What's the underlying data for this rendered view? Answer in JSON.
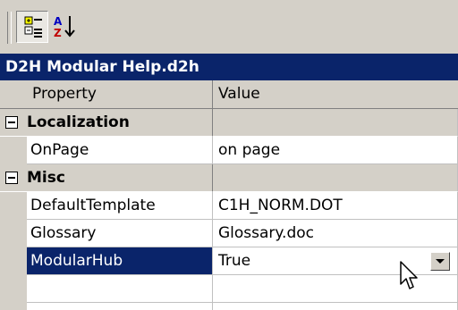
{
  "title": "D2H Modular Help.d2h",
  "toolbar": {
    "categorized_icon": "categorized-icon",
    "alphabetical_icon": "alphabetical-sort-icon"
  },
  "grid": {
    "header": {
      "property": "Property",
      "value": "Value"
    },
    "rows": [
      {
        "type": "category",
        "name": "Localization",
        "value": ""
      },
      {
        "type": "property",
        "name": "OnPage",
        "value": "on page"
      },
      {
        "type": "category",
        "name": "Misc",
        "value": ""
      },
      {
        "type": "property",
        "name": "DefaultTemplate",
        "value": "C1H_NORM.DOT"
      },
      {
        "type": "property",
        "name": "Glossary",
        "value": "Glossary.doc"
      },
      {
        "type": "property",
        "name": "ModularHub",
        "value": "True",
        "selected": true
      }
    ]
  },
  "colors": {
    "selection": "#0a246a",
    "face": "#d4d0c8"
  }
}
